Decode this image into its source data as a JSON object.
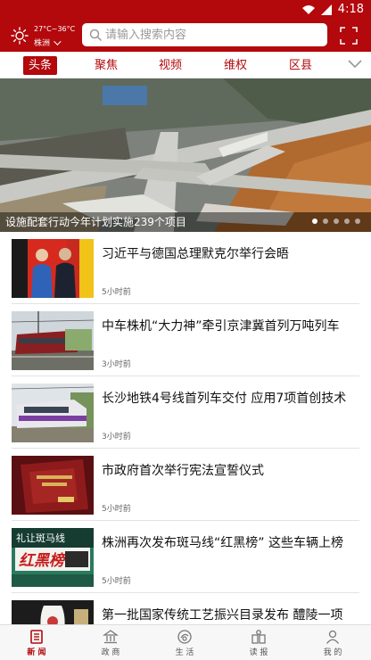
{
  "status_bar": {
    "time": "4:18"
  },
  "header": {
    "weather": {
      "temp": "27°C~36°C",
      "city": "株洲"
    },
    "search": {
      "placeholder": "请输入搜索内容",
      "value": ""
    }
  },
  "tabs": [
    {
      "label": "头条",
      "active": true
    },
    {
      "label": "聚焦",
      "active": false
    },
    {
      "label": "视频",
      "active": false
    },
    {
      "label": "维权",
      "active": false
    },
    {
      "label": "区县",
      "active": false
    }
  ],
  "banner": {
    "caption": "设施配套行动今年计划实施239个项目",
    "slide_count": 5,
    "active_slide": 1
  },
  "news": [
    {
      "title": "习近平与德国总理默克尔举行会晤",
      "time": "5小时前"
    },
    {
      "title": "中车株机“大力神”牵引京津冀首列万吨列车",
      "time": "3小时前"
    },
    {
      "title": "长沙地铁4号线首列车交付 应用7项首创技术",
      "time": "3小时前"
    },
    {
      "title": "市政府首次举行宪法宣誓仪式",
      "time": "5小时前"
    },
    {
      "title": "株洲再次发布斑马线“红黑榜” 这些车辆上榜",
      "time": "5小时前"
    },
    {
      "title": "第一批国家传统工艺振兴目录发布 醴陵一项",
      "time": ""
    }
  ],
  "thumb_text": {
    "sign_top": "礼让斑马线",
    "sign_main": "红黑榜"
  },
  "bottom_nav": [
    {
      "label": "新 闻",
      "icon": "newspaper-icon",
      "active": true
    },
    {
      "label": "政 商",
      "icon": "government-icon",
      "active": false
    },
    {
      "label": "生 活",
      "icon": "life-icon",
      "active": false
    },
    {
      "label": "读 报",
      "icon": "read-paper-icon",
      "active": false
    },
    {
      "label": "我 的",
      "icon": "user-icon",
      "active": false
    }
  ],
  "colors": {
    "brand": "#b3080c",
    "text": "#111111",
    "muted": "#666666"
  }
}
